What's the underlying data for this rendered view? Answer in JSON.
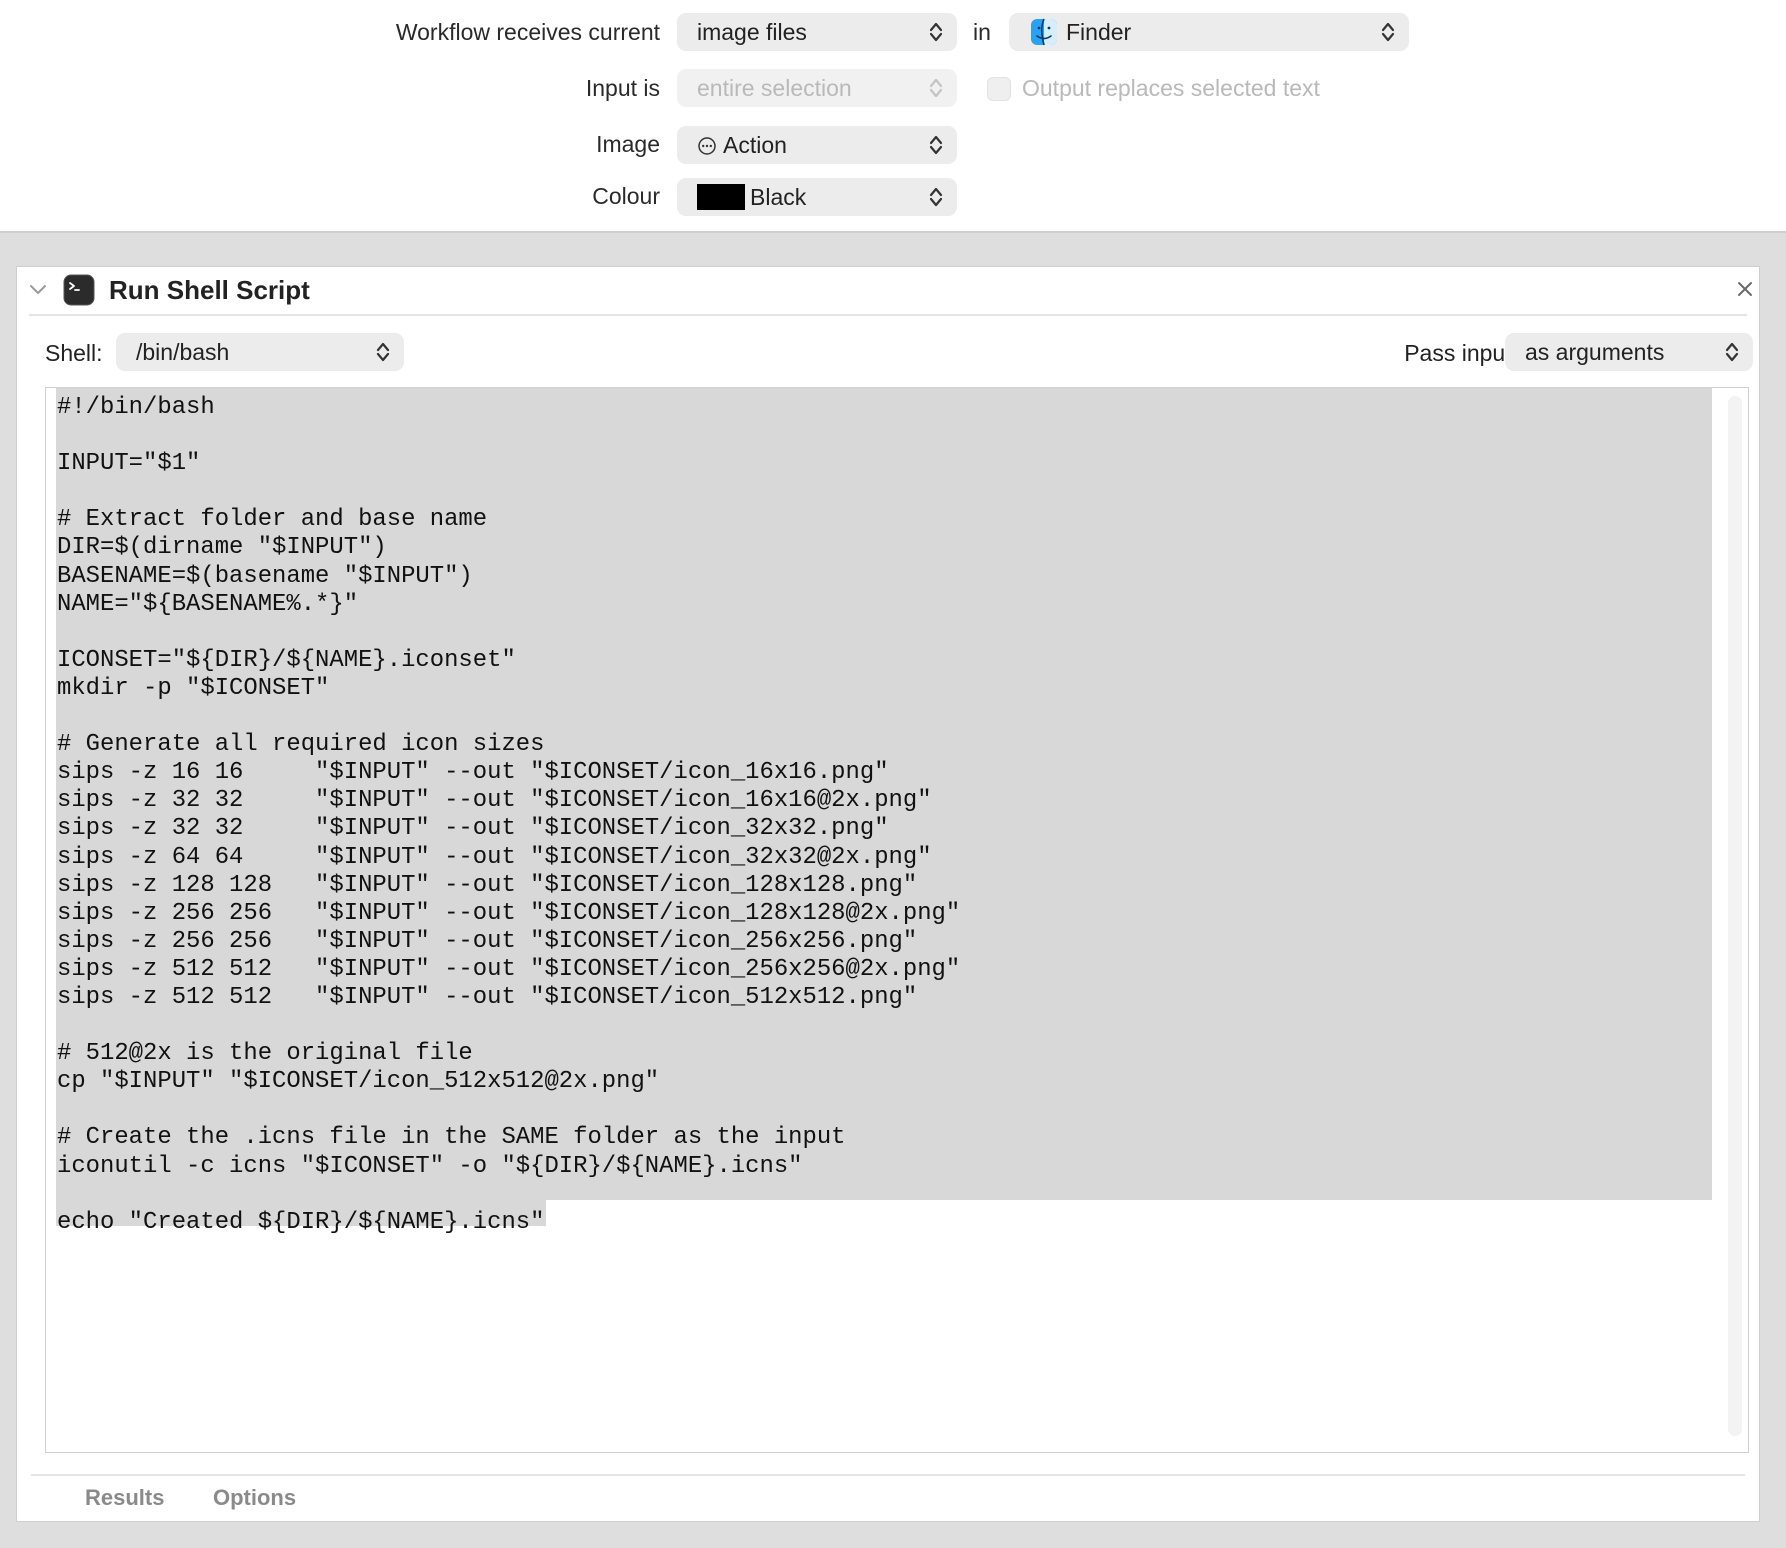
{
  "workflow": {
    "receives_label": "Workflow receives current",
    "input_type": "image files",
    "in_label": "in",
    "application": "Finder",
    "input_is_label": "Input is",
    "input_is_value": "entire selection",
    "output_replaces_label": "Output replaces selected text",
    "image_label": "Image",
    "image_value": "Action",
    "colour_label": "Colour",
    "colour_value": "Black",
    "colour_swatch": "#000000"
  },
  "action": {
    "title": "Run Shell Script",
    "shell_label": "Shell:",
    "shell_value": "/bin/bash",
    "pass_input_label": "Pass input:",
    "pass_input_value": "as arguments",
    "script_lines": [
      "#!/bin/bash",
      "",
      "INPUT=\"$1\"",
      "",
      "# Extract folder and base name",
      "DIR=$(dirname \"$INPUT\")",
      "BASENAME=$(basename \"$INPUT\")",
      "NAME=\"${BASENAME%.*}\"",
      "",
      "ICONSET=\"${DIR}/${NAME}.iconset\"",
      "mkdir -p \"$ICONSET\"",
      "",
      "# Generate all required icon sizes",
      "sips -z 16 16     \"$INPUT\" --out \"$ICONSET/icon_16x16.png\"",
      "sips -z 32 32     \"$INPUT\" --out \"$ICONSET/icon_16x16@2x.png\"",
      "sips -z 32 32     \"$INPUT\" --out \"$ICONSET/icon_32x32.png\"",
      "sips -z 64 64     \"$INPUT\" --out \"$ICONSET/icon_32x32@2x.png\"",
      "sips -z 128 128   \"$INPUT\" --out \"$ICONSET/icon_128x128.png\"",
      "sips -z 256 256   \"$INPUT\" --out \"$ICONSET/icon_128x128@2x.png\"",
      "sips -z 256 256   \"$INPUT\" --out \"$ICONSET/icon_256x256.png\"",
      "sips -z 512 512   \"$INPUT\" --out \"$ICONSET/icon_256x256@2x.png\"",
      "sips -z 512 512   \"$INPUT\" --out \"$ICONSET/icon_512x512.png\"",
      "",
      "# 512@2x is the original file",
      "cp \"$INPUT\" \"$ICONSET/icon_512x512@2x.png\"",
      "",
      "# Create the .icns file in the SAME folder as the input",
      "iconutil -c icns \"$ICONSET\" -o \"${DIR}/${NAME}.icns\"",
      "",
      "echo \"Created ${DIR}/${NAME}.icns\""
    ],
    "footer_results": "Results",
    "footer_options": "Options"
  },
  "icons": {
    "terminal": "terminal-icon",
    "finder": "finder-icon",
    "action": "ellipsis-circle-icon",
    "disclosure": "chevron-down-icon",
    "close": "close-icon",
    "popup_arrows": "up-down-chevron-icon"
  }
}
